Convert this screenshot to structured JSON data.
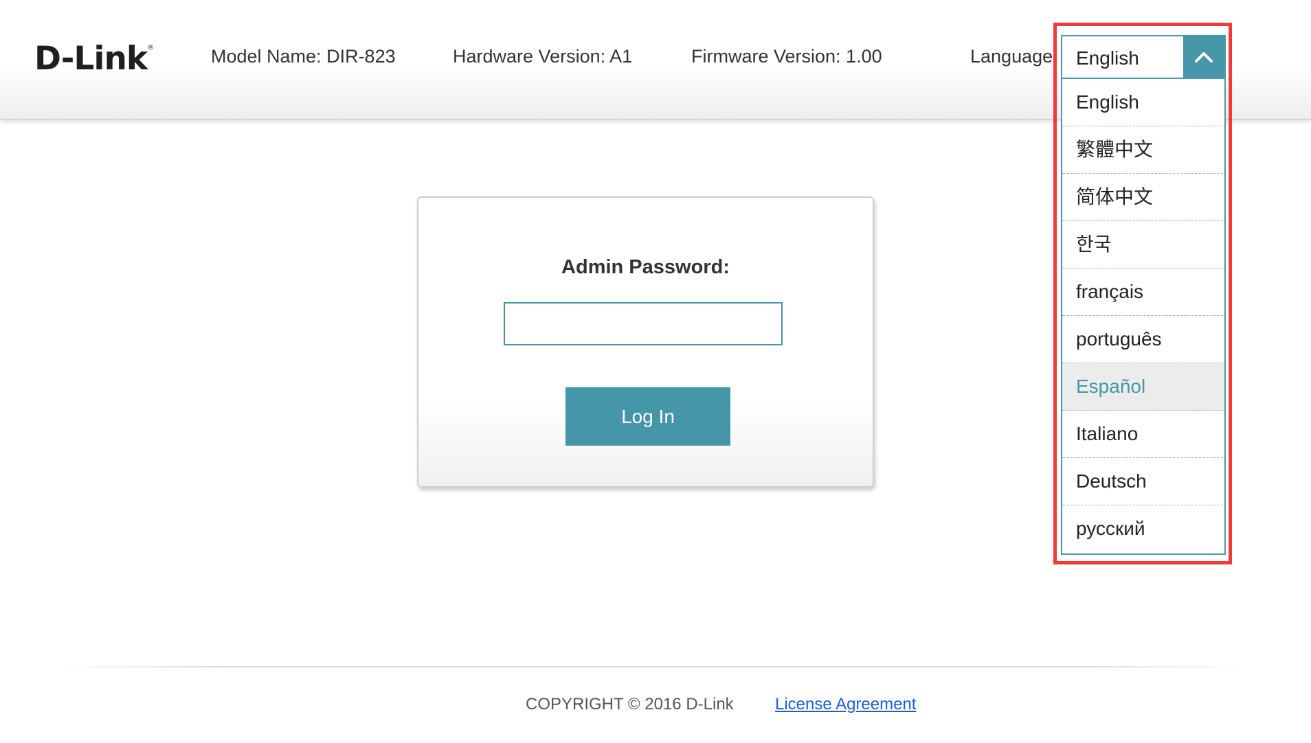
{
  "header": {
    "logo_text": "D-Link",
    "logo_mark": "®",
    "model": "Model Name: DIR-823",
    "hardware": "Hardware Version: A1",
    "firmware": "Firmware Version: 1.00",
    "language_label": "Language"
  },
  "language": {
    "selected": "English",
    "arrow_icon": "chevron-up-icon",
    "options": [
      "English",
      "繁體中文",
      "简体中文",
      "한국",
      "français",
      "português",
      "Español",
      "Italiano",
      "Deutsch",
      "русский"
    ],
    "hovered": "Español"
  },
  "login": {
    "password_label": "Admin Password:",
    "password_value": "",
    "login_button": "Log In"
  },
  "footer": {
    "copyright": "COPYRIGHT © 2016 D-Link",
    "license": "License Agreement"
  },
  "colors": {
    "accent": "#4596a8",
    "highlight_box": "#ee3b3b",
    "link": "#1a5fd6"
  }
}
